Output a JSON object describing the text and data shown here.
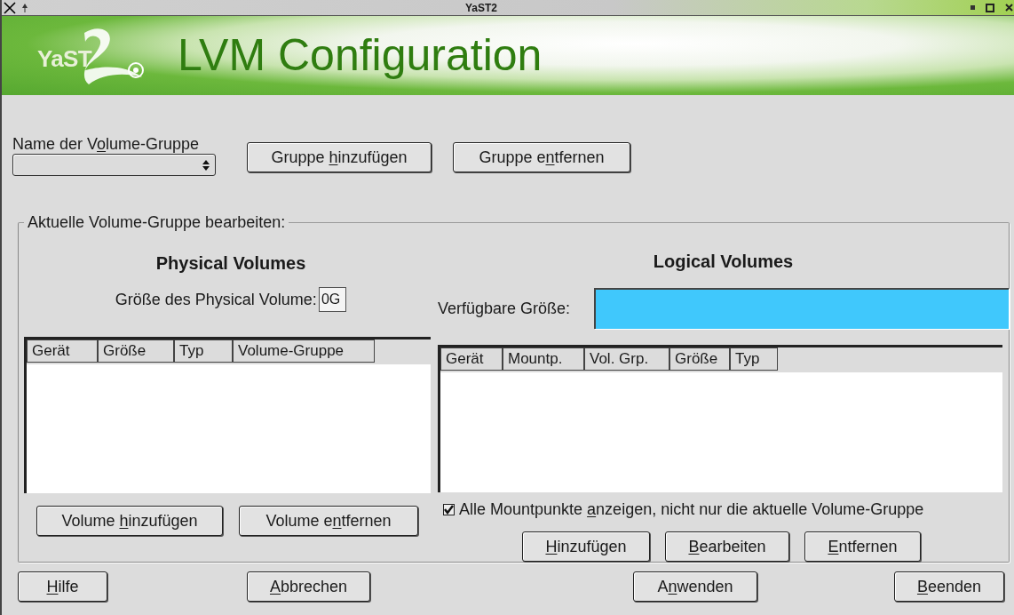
{
  "window": {
    "title": "YaST2"
  },
  "banner": {
    "logo_text": "YaST",
    "title": "LVM Configuration"
  },
  "volume_group": {
    "label": {
      "pre": "Name der V",
      "key": "o",
      "post": "lume-Gruppe"
    }
  },
  "group_buttons": [
    {
      "label": {
        "pre": "Gruppe ",
        "key": "h",
        "post": "inzufügen"
      }
    },
    {
      "label": {
        "pre": "Gruppe e",
        "key": "n",
        "post": "tfernen"
      }
    }
  ],
  "edit_group": {
    "legend": "Aktuelle Volume-Gruppe bearbeiten:"
  },
  "physical": {
    "heading": "Physical Volumes",
    "size_label": "Größe des Physical Volume:",
    "size_value": "0G",
    "columns": [
      "Gerät",
      "Größe",
      "Typ",
      "Volume-Gruppe"
    ],
    "buttons": [
      {
        "label": {
          "pre": "Volume ",
          "key": "h",
          "post": "inzufügen"
        }
      },
      {
        "label": {
          "pre": "Volume e",
          "key": "n",
          "post": "tfernen"
        }
      }
    ]
  },
  "logical": {
    "heading": "Logical Volumes",
    "available_label": "Verfügbare Größe:",
    "columns": [
      "Gerät",
      "Mountp.",
      "Vol. Grp.",
      "Größe",
      "Typ"
    ],
    "show_all": {
      "label": {
        "pre": "Alle Mountpunkte ",
        "key": "a",
        "post": "nzeigen, nicht nur die aktuelle Volume-Gruppe"
      },
      "checked": true
    },
    "buttons": [
      {
        "label": {
          "key": "H",
          "post": "inzufügen"
        }
      },
      {
        "label": {
          "key": "B",
          "post": "earbeiten"
        }
      },
      {
        "label": {
          "key": "E",
          "post": "ntfernen"
        }
      }
    ]
  },
  "footer_buttons": [
    {
      "label": {
        "key": "H",
        "post": "ilfe"
      }
    },
    {
      "label": {
        "key": "A",
        "post": "bbrechen"
      }
    },
    {
      "label": {
        "pre": "A",
        "key": "n",
        "post": "wenden"
      }
    },
    {
      "label": {
        "key": "B",
        "post": "eenden"
      }
    }
  ]
}
